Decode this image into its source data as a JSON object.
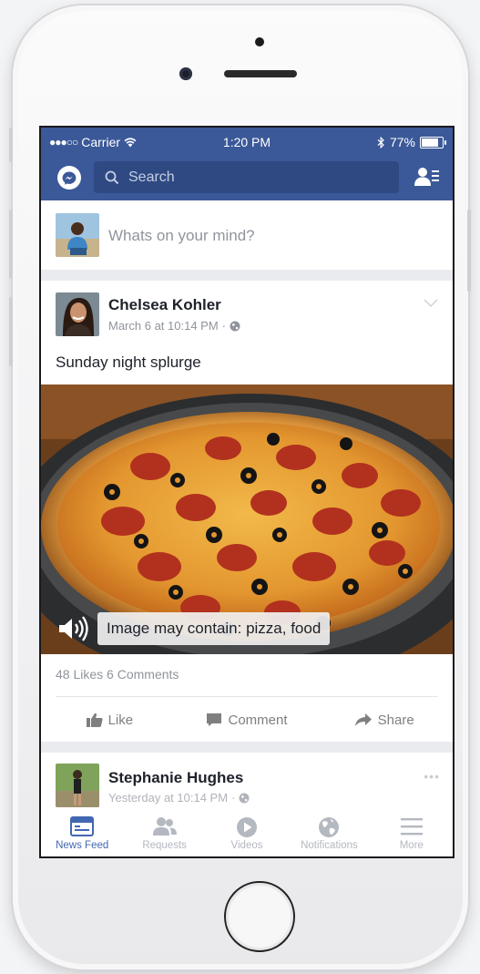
{
  "status_bar": {
    "carrier": "Carrier",
    "time": "1:20 PM",
    "battery": "77%"
  },
  "header": {
    "search_placeholder": "Search"
  },
  "composer": {
    "prompt": "Whats on your mind?"
  },
  "post1": {
    "author": "Chelsea Kohler",
    "timestamp": "March 6 at 10:14 PM",
    "text": "Sunday night splurge",
    "alt_text": "Image may contain: pizza, food",
    "likes": "48 Likes",
    "comments": "6 Comments",
    "actions": {
      "like": "Like",
      "comment": "Comment",
      "share": "Share"
    }
  },
  "post2": {
    "author": "Stephanie Hughes",
    "timestamp": "Yesterday at 10:14 PM"
  },
  "tabs": [
    {
      "label": "News Feed",
      "icon": "news-feed-icon",
      "active": true
    },
    {
      "label": "Requests",
      "icon": "friend-requests-icon",
      "active": false
    },
    {
      "label": "Videos",
      "icon": "video-play-icon",
      "active": false
    },
    {
      "label": "Notifications",
      "icon": "globe-icon",
      "active": false
    },
    {
      "label": "More",
      "icon": "hamburger-menu-icon",
      "active": false
    }
  ],
  "colors": {
    "brand": "#3b5998",
    "search_bg": "#2f4a83",
    "active_tab": "#4267b2",
    "meta_text": "#90949c"
  }
}
